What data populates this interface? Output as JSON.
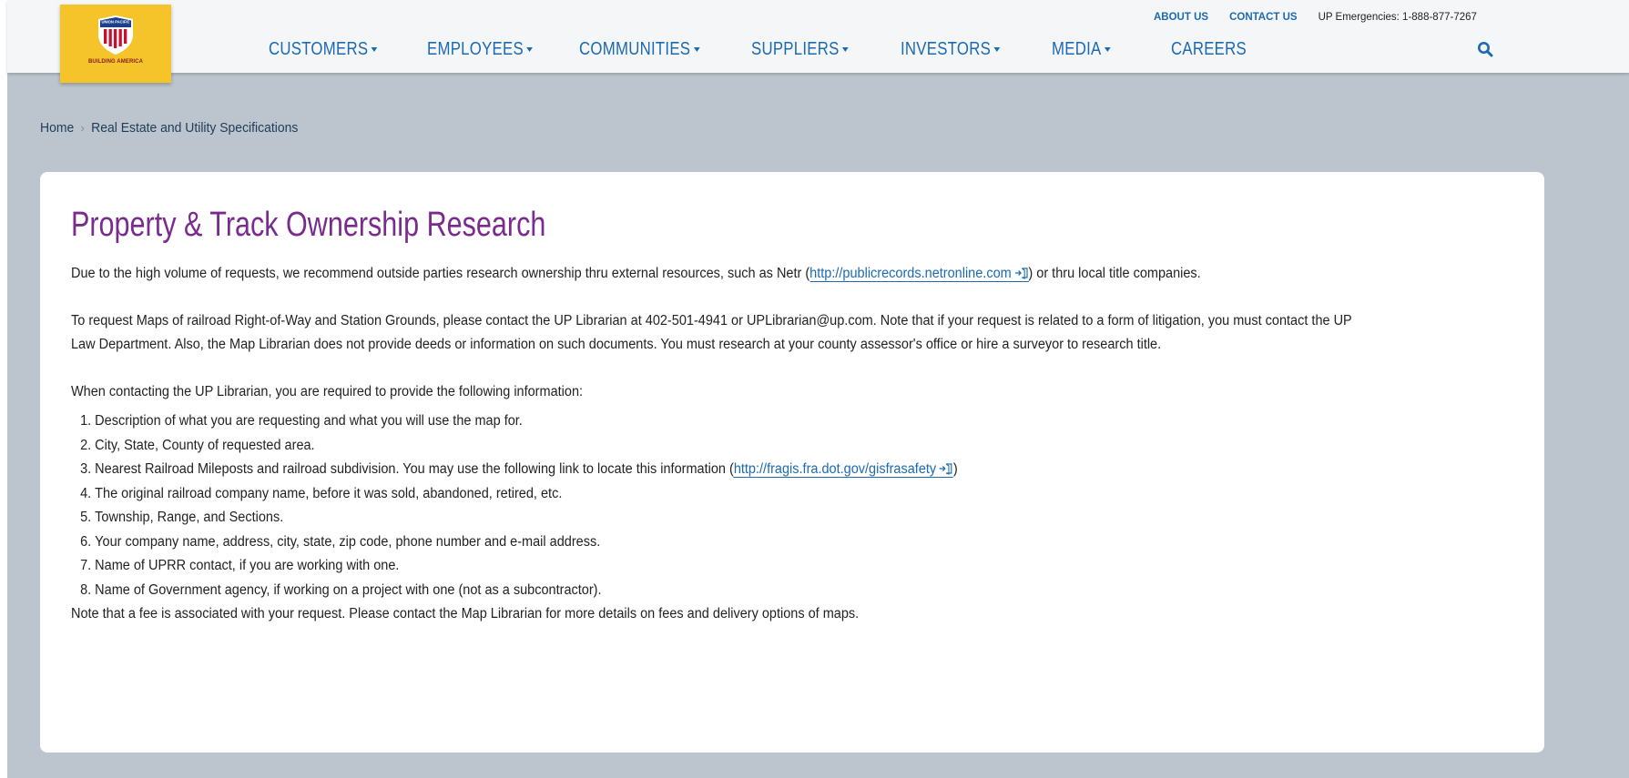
{
  "header": {
    "logo": {
      "brand": "UNION PACIFIC",
      "tagline": "BUILDING AMERICA",
      "colors": {
        "background": "#f5c42b",
        "shield_blue": "#1b3f8a",
        "shield_red": "#c8102e"
      }
    },
    "utility_links": {
      "about": "ABOUT US",
      "contact": "CONTACT US",
      "emergency": "UP Emergencies: 1-888-877-7267"
    },
    "nav": {
      "customers": "CUSTOMERS",
      "employees": "EMPLOYEES",
      "communities": "COMMUNITIES",
      "suppliers": "SUPPLIERS",
      "investors": "INVESTORS",
      "media": "MEDIA",
      "careers": "CAREERS",
      "search_icon": "search-icon"
    }
  },
  "breadcrumb": {
    "home": "Home",
    "current": "Real Estate and Utility Specifications"
  },
  "article": {
    "title": "Property & Track Ownership Research",
    "p1_before": "Due to the high volume of requests, we recommend outside parties research ownership thru external resources, such as Netr (",
    "p1_link": "http://publicrecords.netronline.com",
    "p1_after": ") or thru local title companies.",
    "p2": "To request Maps of railroad Right-of-Way and Station Grounds, please contact the UP Librarian at 402-501-4941 or UPLibrarian@up.com. Note that if your request is related to a form of litigation, you must contact the UP Law Department. Also, the Map Librarian does not provide deeds or information on such documents. You must research at your county assessor's office or hire a surveyor to research title.",
    "p3": "When contacting the UP Librarian, you are required to provide the following information:",
    "list": {
      "item1": "Description of what you are requesting and what you will use the map for.",
      "item2": "City, State, County of requested area.",
      "item3_before": "Nearest Railroad Mileposts and railroad subdivision. You may use the following link to locate this information (",
      "item3_link": "http://fragis.fra.dot.gov/gisfrasafety",
      "item3_after": ")",
      "item4": "The original railroad company name, before it was sold, abandoned, retired, etc.",
      "item5": "Township, Range, and Sections.",
      "item6": "Your company name, address, city, state, zip code, phone number and e-mail address.",
      "item7": "Name of UPRR contact, if you are working with one.",
      "item8": "Name of Government agency, if working on a project with one (not as a subcontractor)."
    },
    "note": "Note that a fee is associated with your request. Please contact the Map Librarian for more details on fees and delivery options of maps.",
    "external_link_icon": "external-link-icon"
  },
  "colors": {
    "page_background": "#bcc5cd",
    "header_background": "#f5f6f7",
    "link": "#1b6ab2",
    "title": "#7a2b8e"
  }
}
